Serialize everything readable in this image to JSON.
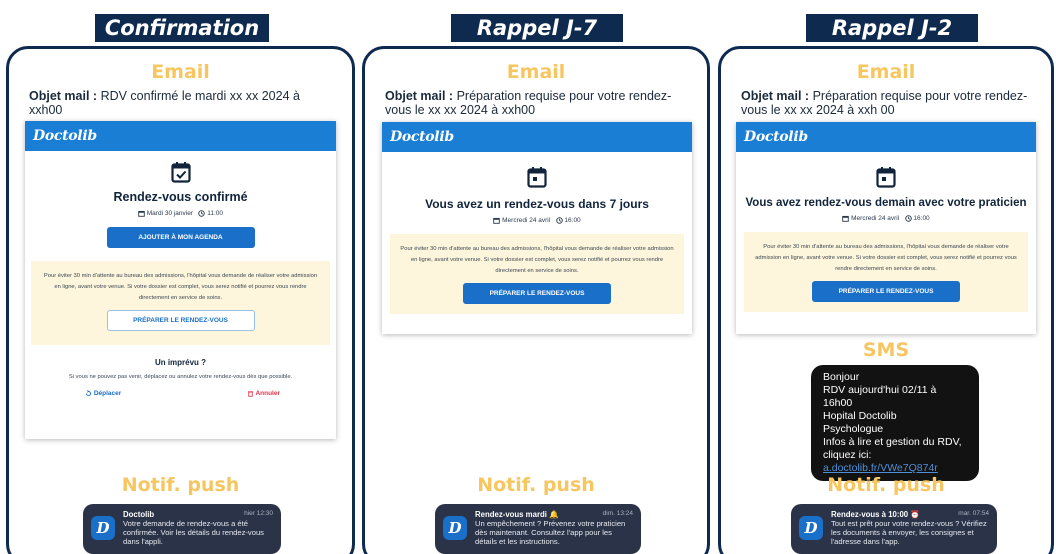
{
  "columns": [
    {
      "title": "Confirmation",
      "email_heading": "Email",
      "subject_label": "Objet mail :",
      "subject_text": "RDV confirmé le mardi xx xx 2024 à xxh00",
      "brand": "Doctolib",
      "headline": "Rendez-vous confirmé",
      "date": "Mardi 30 janvier",
      "time": "11:00",
      "primary_button": "AJOUTER À MON AGENDA",
      "info_text": "Pour éviter 30 min d'attente au bureau des admissions, l'hôpital vous demande de réaliser votre admission en ligne, avant votre venue. Si votre dossier est complet, vous serez notifié et pourrez vous rendre directement en service de soins.",
      "secondary_button": "PRÉPARER LE RENDEZ-VOUS",
      "unexpected_title": "Un imprévu ?",
      "unexpected_text": "Si vous ne pouvez pas venir, déplacez ou annulez votre rendez-vous dès que possible.",
      "move_link": "Déplacer",
      "cancel_link": "Annuler",
      "push_heading": "Notif. push",
      "push": {
        "app": "Doctolib",
        "time": "hier 12:30",
        "body": "Votre demande de rendez-vous a été confirmée. Voir les détails du rendez-vous dans l'appli."
      }
    },
    {
      "title": "Rappel J-7",
      "email_heading": "Email",
      "subject_label": "Objet mail :",
      "subject_text": "Préparation requise pour votre rendez-vous le xx xx 2024 à xxh00",
      "brand": "Doctolib",
      "headline": "Vous avez un rendez-vous dans 7 jours",
      "date": "Mercredi 24 avril",
      "time": "16:00",
      "info_text": "Pour éviter 30 min d'attente au bureau des admissions, l'hôpital vous demande de réaliser votre admission en ligne, avant votre venue. Si votre dossier est complet, vous serez notifié et pourrez vous rendre directement en service de soins.",
      "primary_button": "PRÉPARER LE RENDEZ-VOUS",
      "push_heading": "Notif. push",
      "push": {
        "app": "Rendez-vous mardi 🔔",
        "time": "dim. 13:24",
        "body": "Un empêchement ? Prévenez votre praticien dès maintenant. Consultez l'app pour les détails et les instructions."
      }
    },
    {
      "title": "Rappel J-2",
      "email_heading": "Email",
      "subject_label": "Objet mail :",
      "subject_text": "Préparation requise pour votre rendez-vous le xx xx 2024 à xxh 00",
      "brand": "Doctolib",
      "headline": "Vous avez rendez-vous demain avec votre praticien",
      "date": "Mercredi 24 avril",
      "time": "16:00",
      "info_text": "Pour éviter 30 min d'attente au bureau des admissions, l'hôpital vous demande de réaliser votre admission en ligne, avant votre venue. Si votre dossier est complet, vous serez notifié et pourrez vous rendre directement en service de soins.",
      "primary_button": "PRÉPARER LE RENDEZ-VOUS",
      "sms_heading": "SMS",
      "sms_lines": [
        "Bonjour",
        "RDV aujourd'hui 02/11 à 16h00",
        "Hopital Doctolib",
        "Psychologue",
        "Infos à lire et gestion du RDV,"
      ],
      "sms_link_prefix": "cliquez ici:",
      "sms_link": "a.doctolib.fr/VWe7Q874r",
      "push_heading": "Notif. push",
      "push": {
        "app": "Rendez-vous à 10:00 ⏰",
        "time": "mar. 07:54",
        "body": "Tout est prêt pour votre rendez-vous ? Vérifiez les documents à envoyer, les consignes et l'adresse dans l'app."
      }
    }
  ],
  "colors": {
    "navy": "#0e2a4e",
    "doctolib_blue": "#1a7fd4",
    "accent_yellow": "#f6c661",
    "info_bg": "#fdf6dd",
    "cancel_red": "#e0334a"
  },
  "icons": [
    "calendar-check-icon",
    "calendar-icon",
    "clock-icon",
    "move-icon",
    "trash-icon",
    "doctolib-app-icon"
  ]
}
